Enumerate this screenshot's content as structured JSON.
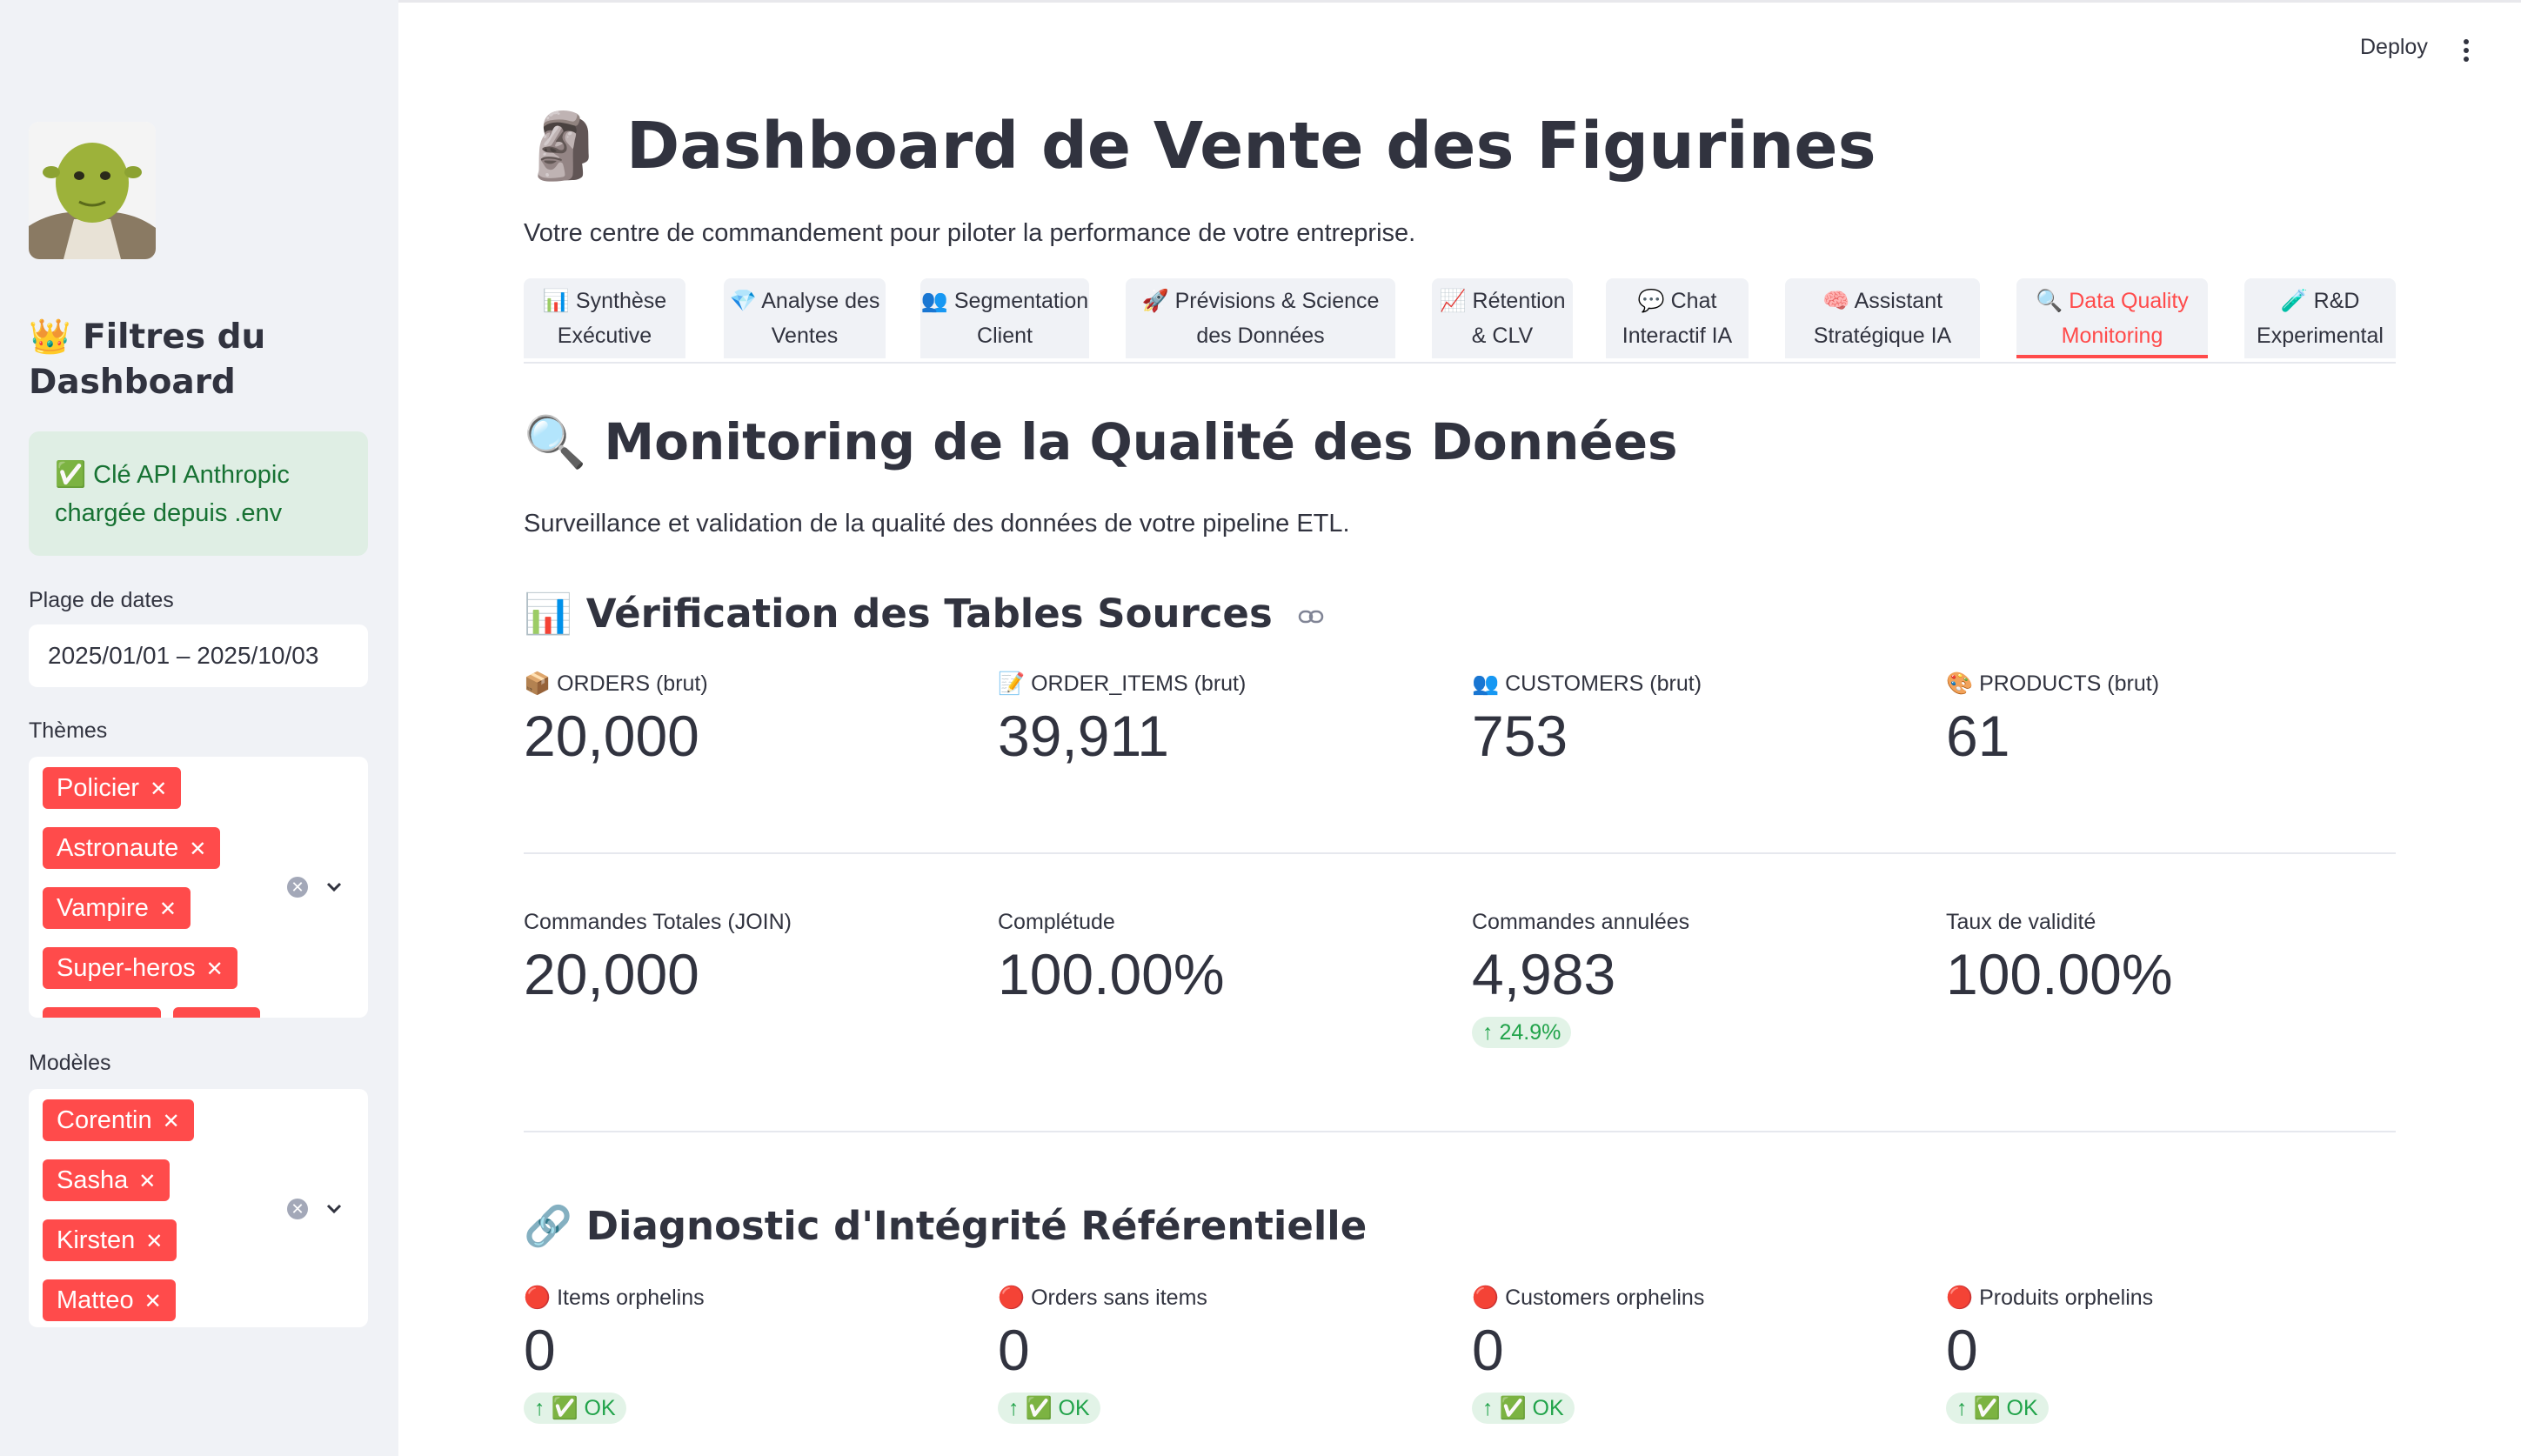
{
  "sidebar": {
    "title": "👑 Filtres du Dashboard",
    "alert": "✅ Clé API Anthropic chargée depuis .env",
    "date_label": "Plage de dates",
    "date_value": "2025/01/01 – 2025/10/03",
    "themes_label": "Thèmes",
    "themes": [
      "Policier",
      "Astronaute",
      "Vampire",
      "Super-heros"
    ],
    "models_label": "Modèles",
    "models": [
      "Corentin",
      "Sasha",
      "Kirsten",
      "Matteo"
    ]
  },
  "header": {
    "deploy_label": "Deploy"
  },
  "main": {
    "title": "🗿 Dashboard de Vente des Figurines",
    "subtitle": "Votre centre de commandement pour piloter la performance de votre entreprise.",
    "tabs": [
      {
        "line1": "📊 Synthèse",
        "line2": "Exécutive"
      },
      {
        "line1": "💎 Analyse des",
        "line2": "Ventes"
      },
      {
        "line1": "👥 Segmentation",
        "line2": "Client"
      },
      {
        "line1": "🚀 Prévisions & Science",
        "line2": "des Données"
      },
      {
        "line1": "📈 Rétention",
        "line2": "& CLV"
      },
      {
        "line1": "💬 Chat",
        "line2": "Interactif IA"
      },
      {
        "line1": "🧠 Assistant",
        "line2": "Stratégique IA"
      },
      {
        "line1": "🔍 Data Quality",
        "line2": "Monitoring"
      },
      {
        "line1": "🧪 R&D",
        "line2": "Experimental"
      }
    ],
    "active_tab": 7,
    "section_title": "🔍 Monitoring de la Qualité des Données",
    "section_desc": "Surveillance et validation de la qualité des données de votre pipeline ETL.",
    "sources_title": "📊 Vérification des Tables Sources",
    "sources": [
      {
        "label": "📦 ORDERS (brut)",
        "value": "20,000"
      },
      {
        "label": "📝 ORDER_ITEMS (brut)",
        "value": "39,911"
      },
      {
        "label": "👥 CUSTOMERS (brut)",
        "value": "753"
      },
      {
        "label": "🎨 PRODUCTS (brut)",
        "value": "61"
      }
    ],
    "join_metrics": [
      {
        "label": "Commandes Totales (JOIN)",
        "value": "20,000"
      },
      {
        "label": "Complétude",
        "value": "100.00%"
      },
      {
        "label": "Commandes annulées",
        "value": "4,983",
        "delta": "↑ 24.9%"
      },
      {
        "label": "Taux de validité",
        "value": "100.00%"
      }
    ],
    "integrity_title": "🔗 Diagnostic d'Intégrité Référentielle",
    "integrity": [
      {
        "label": "🔴 Items orphelins",
        "value": "0",
        "delta": "↑ ✅ OK"
      },
      {
        "label": "🔴 Orders sans items",
        "value": "0",
        "delta": "↑ ✅ OK"
      },
      {
        "label": "🔴 Customers orphelins",
        "value": "0",
        "delta": "↑ ✅ OK"
      },
      {
        "label": "🔴 Produits orphelins",
        "value": "0",
        "delta": "↑ ✅ OK"
      }
    ]
  },
  "colors": {
    "accent": "#ff4b4b",
    "sidebar_bg": "#f0f2f6",
    "success": "#21a34a"
  }
}
